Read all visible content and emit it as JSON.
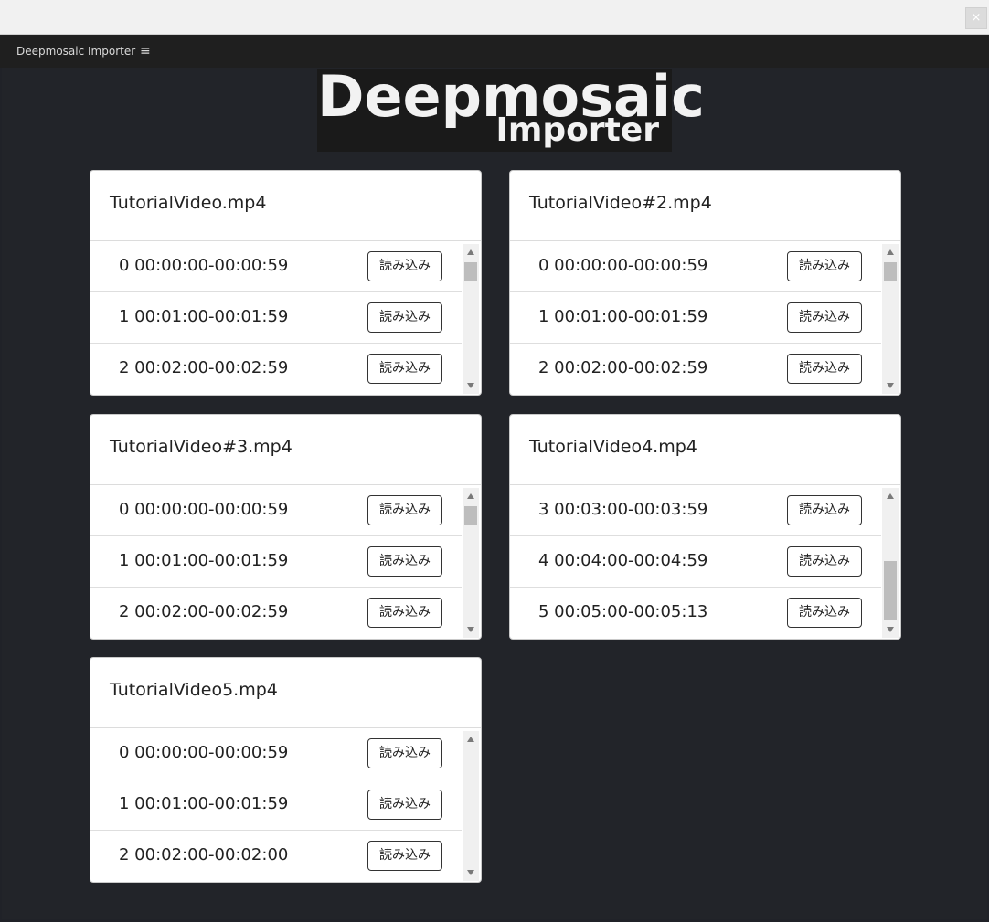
{
  "window": {
    "close_label": "×"
  },
  "panel": {
    "title": "Deepmosaic Importer",
    "menu_glyph": "≡"
  },
  "logo": {
    "line1": "Deepmosaic",
    "line2": "Importer"
  },
  "load_label": "読み込み",
  "cards": [
    {
      "title": "TutorialVideo.mp4",
      "rows": [
        {
          "text": "0 00:00:00-00:00:59",
          "button": "読み込み"
        },
        {
          "text": "1 00:01:00-00:01:59",
          "button": "読み込み"
        },
        {
          "text": "2 00:02:00-00:02:59",
          "button": "読み込み"
        }
      ]
    },
    {
      "title": "TutorialVideo#2.mp4",
      "rows": [
        {
          "text": "0 00:00:00-00:00:59",
          "button": "読み込み"
        },
        {
          "text": "1 00:01:00-00:01:59",
          "button": "読み込み"
        },
        {
          "text": "2 00:02:00-00:02:59",
          "button": "読み込み"
        }
      ]
    },
    {
      "title": "TutorialVideo#3.mp4",
      "rows": [
        {
          "text": "0 00:00:00-00:00:59",
          "button": "読み込み"
        },
        {
          "text": "1 00:01:00-00:01:59",
          "button": "読み込み"
        },
        {
          "text": "2 00:02:00-00:02:59",
          "button": "読み込み"
        }
      ]
    },
    {
      "title": "TutorialVideo4.mp4",
      "rows": [
        {
          "text": "3 00:03:00-00:03:59",
          "button": "読み込み"
        },
        {
          "text": "4 00:04:00-00:04:59",
          "button": "読み込み"
        },
        {
          "text": "5 00:05:00-00:05:13",
          "button": "読み込み"
        }
      ]
    },
    {
      "title": "TutorialVideo5.mp4",
      "rows": [
        {
          "text": "0 00:00:00-00:00:59",
          "button": "読み込み"
        },
        {
          "text": "1 00:01:00-00:01:59",
          "button": "読み込み"
        },
        {
          "text": "2 00:02:00-00:02:00",
          "button": "読み込み"
        }
      ]
    }
  ]
}
